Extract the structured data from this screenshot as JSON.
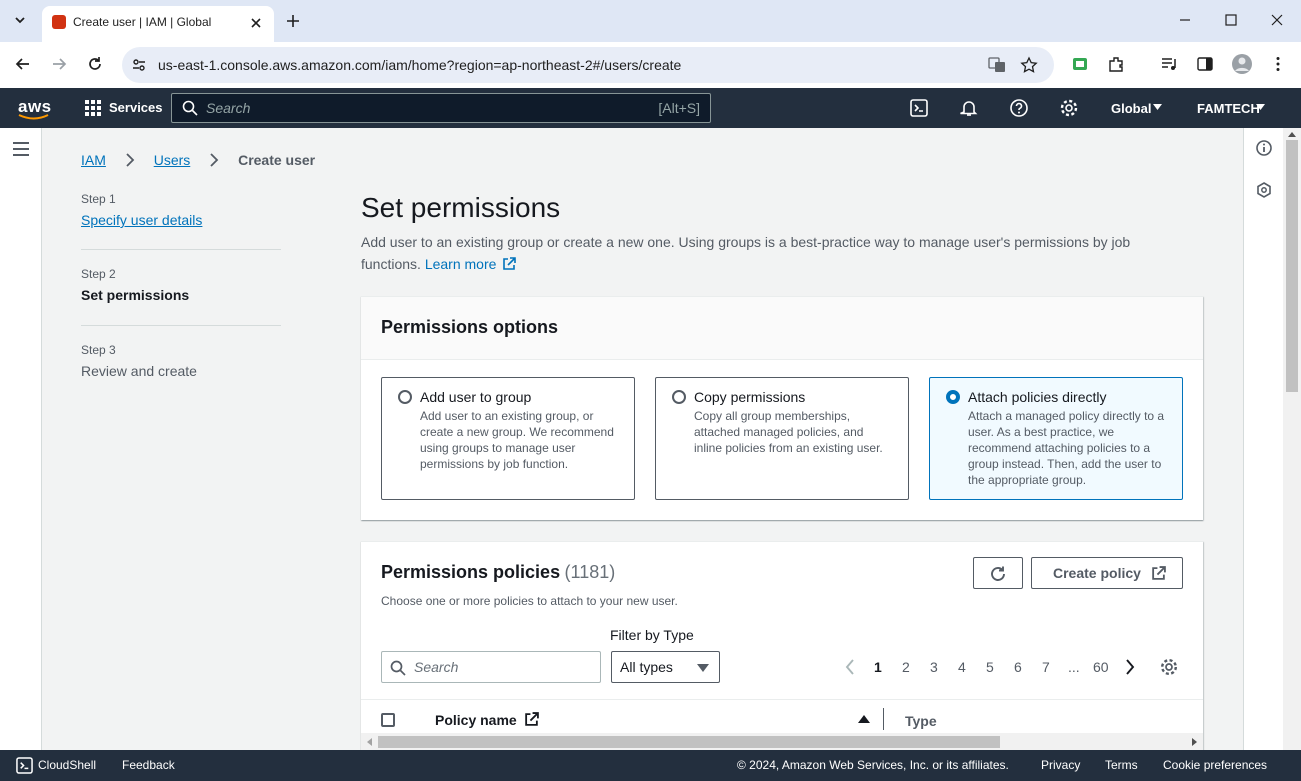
{
  "browser": {
    "tab_title": "Create user | IAM | Global",
    "url": "us-east-1.console.aws.amazon.com/iam/home?region=ap-northeast-2#/users/create"
  },
  "header": {
    "logo": "aws",
    "services_label": "Services",
    "search_placeholder": "Search",
    "search_shortcut": "[Alt+S]",
    "region": "Global",
    "account": "FAMTECH"
  },
  "breadcrumb": [
    "IAM",
    "Users",
    "Create user"
  ],
  "steps": [
    {
      "num": "Step 1",
      "name": "Specify user details"
    },
    {
      "num": "Step 2",
      "name": "Set permissions"
    },
    {
      "num": "Step 3",
      "name": "Review and create"
    }
  ],
  "main": {
    "title": "Set permissions",
    "description": "Add user to an existing group or create a new one. Using groups is a best-practice way to manage user's permissions by job",
    "description2": "functions.",
    "learn_more": "Learn more"
  },
  "permission_options": {
    "title": "Permissions options",
    "options": [
      {
        "title": "Add user to group",
        "desc": "Add user to an existing group, or create a new group. We recommend using groups to manage user permissions by job function.",
        "selected": false
      },
      {
        "title": "Copy permissions",
        "desc": "Copy all group memberships, attached managed policies, and inline policies from an existing user.",
        "selected": false
      },
      {
        "title": "Attach policies directly",
        "desc": "Attach a managed policy directly to a user. As a best practice, we recommend attaching policies to a group instead. Then, add the user to the appropriate group.",
        "selected": true
      }
    ]
  },
  "policies": {
    "title": "Permissions policies",
    "count": "(1181)",
    "subtitle": "Choose one or more policies to attach to your new user.",
    "create_label": "Create policy",
    "search_placeholder": "Search",
    "filter_label": "Filter by Type",
    "filter_value": "All types",
    "pages": [
      "1",
      "2",
      "3",
      "4",
      "5",
      "6",
      "7",
      "...",
      "60"
    ],
    "current_page": "1",
    "columns": [
      "Policy name",
      "Type"
    ]
  },
  "footer": {
    "cloudshell": "CloudShell",
    "feedback": "Feedback",
    "copyright": "© 2024, Amazon Web Services, Inc. or its affiliates.",
    "privacy": "Privacy",
    "terms": "Terms",
    "cookies": "Cookie preferences"
  },
  "colors": {
    "aws_header": "#232f3e",
    "link": "#0073bb",
    "selected_bg": "#f1faff"
  }
}
